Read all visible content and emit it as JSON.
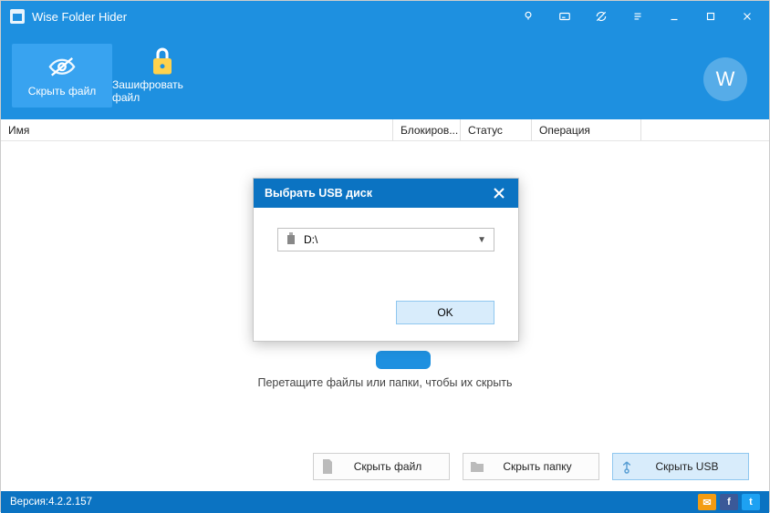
{
  "titlebar": {
    "title": "Wise Folder Hider"
  },
  "ribbon": {
    "hide_label": "Скрыть файл",
    "encrypt_label": "Зашифровать файл",
    "logo_letter": "W"
  },
  "columns": {
    "name": "Имя",
    "lock": "Блокиров...",
    "status": "Статус",
    "operation": "Операция"
  },
  "workspace": {
    "drop_hint": "Перетащите файлы или папки, чтобы их скрыть"
  },
  "bottom": {
    "hide_file": "Скрыть файл",
    "hide_folder": "Скрыть папку",
    "hide_usb": "Скрыть USB"
  },
  "statusbar": {
    "version_label": "Версия:",
    "version_value": "4.2.2.157"
  },
  "dialog": {
    "title": "Выбрать USB диск",
    "selected_drive": "D:\\",
    "ok_label": "OK"
  }
}
